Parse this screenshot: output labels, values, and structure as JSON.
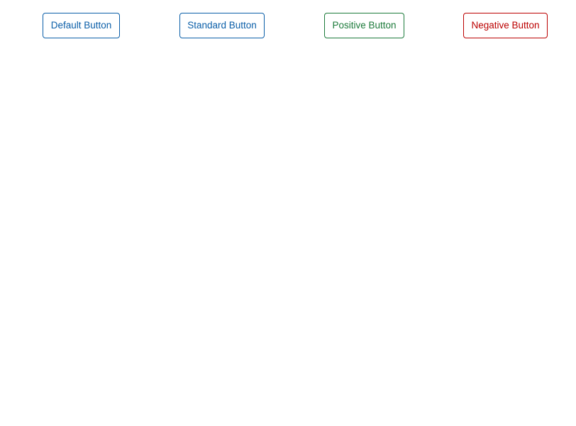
{
  "buttons": {
    "default": {
      "label": "Default Button",
      "color": "#0a5ea8"
    },
    "standard": {
      "label": "Standard Button",
      "color": "#0a5ea8"
    },
    "positive": {
      "label": "Positive Button",
      "color": "#1b7a3a"
    },
    "negative": {
      "label": "Negative Button",
      "color": "#bb0000"
    }
  }
}
